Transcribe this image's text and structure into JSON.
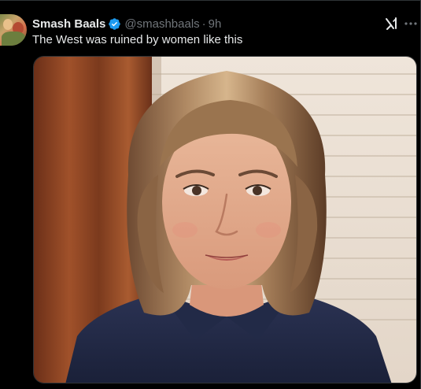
{
  "post": {
    "display_name": "Smash Baals",
    "verified": true,
    "verified_icon": "verified-badge-icon",
    "handle": "@smashbaals",
    "separator": "·",
    "time": "9h",
    "text": "The West was ruined by women like this",
    "actions": {
      "grok_icon": "grok-icon",
      "more_icon": "more-options-icon"
    },
    "media": {
      "type": "photo"
    }
  },
  "colors": {
    "background": "#000000",
    "text_primary": "#e7e9ea",
    "text_secondary": "#71767b",
    "verified_blue": "#1d9bf0",
    "border": "#2f3336"
  }
}
